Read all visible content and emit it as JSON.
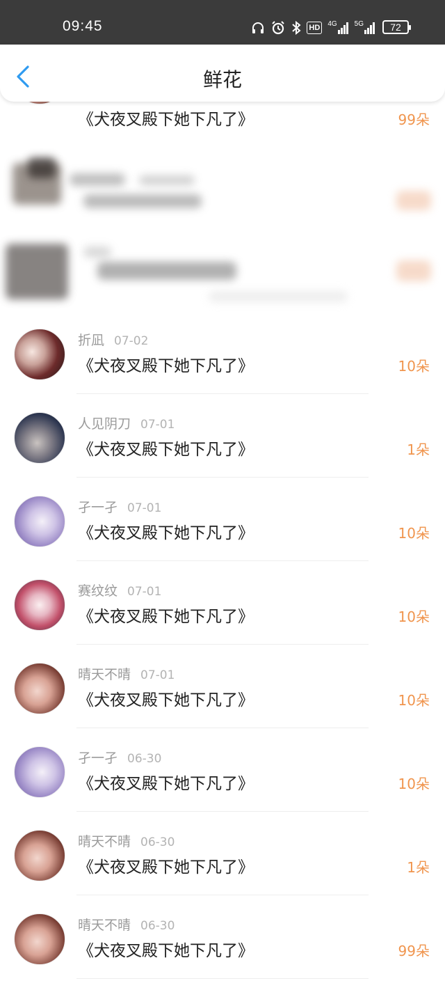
{
  "status": {
    "time": "09:45",
    "hd_label": "HD",
    "net4g": "4G",
    "net5g": "5G",
    "battery": "72"
  },
  "header": {
    "title": "鲜花"
  },
  "partial_top": {
    "book": "《犬夜叉殿下她下凡了》",
    "amount": "99朵"
  },
  "rows": [
    {
      "name": "折凪",
      "date": "07-02",
      "book": "《犬夜叉殿下她下凡了》",
      "amount": "10朵"
    },
    {
      "name": "人见阴刀",
      "date": "07-01",
      "book": "《犬夜叉殿下她下凡了》",
      "amount": "1朵"
    },
    {
      "name": "孑一孑",
      "date": "07-01",
      "book": "《犬夜叉殿下她下凡了》",
      "amount": "10朵"
    },
    {
      "name": "赛纹纹",
      "date": "07-01",
      "book": "《犬夜叉殿下她下凡了》",
      "amount": "10朵"
    },
    {
      "name": "晴天不晴",
      "date": "07-01",
      "book": "《犬夜叉殿下她下凡了》",
      "amount": "10朵"
    },
    {
      "name": "孑一孑",
      "date": "06-30",
      "book": "《犬夜叉殿下她下凡了》",
      "amount": "10朵"
    },
    {
      "name": "晴天不晴",
      "date": "06-30",
      "book": "《犬夜叉殿下她下凡了》",
      "amount": "1朵"
    },
    {
      "name": "晴天不晴",
      "date": "06-30",
      "book": "《犬夜叉殿下她下凡了》",
      "amount": "99朵"
    }
  ],
  "colors": {
    "amount": "#f0954e",
    "status_bar": "#3b3b3b",
    "back_arrow": "#2f9bf0"
  }
}
